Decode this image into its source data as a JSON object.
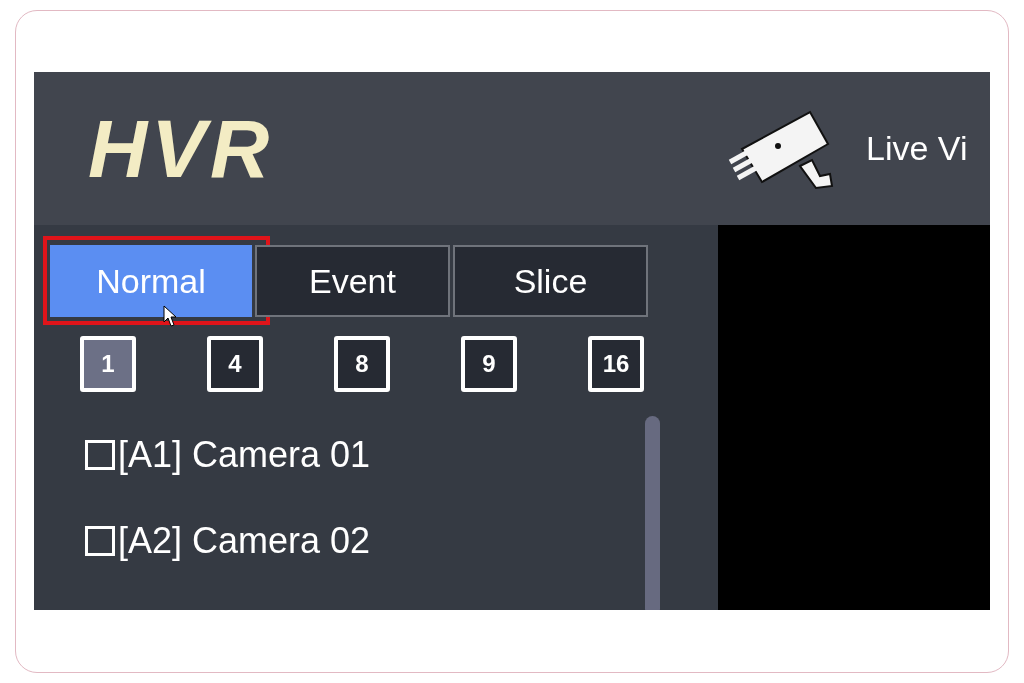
{
  "header": {
    "logo": "HVR",
    "nav_item": "Live Vi"
  },
  "tabs": [
    {
      "label": "Normal",
      "selected": true,
      "highlighted": true
    },
    {
      "label": "Event",
      "selected": false,
      "highlighted": false
    },
    {
      "label": "Slice",
      "selected": false,
      "highlighted": false
    }
  ],
  "layouts": [
    {
      "label": "1",
      "selected": true
    },
    {
      "label": "4",
      "selected": false
    },
    {
      "label": "8",
      "selected": false
    },
    {
      "label": "9",
      "selected": false
    },
    {
      "label": "16",
      "selected": false
    }
  ],
  "cameras": [
    {
      "label": "[A1] Camera 01",
      "checked": false
    },
    {
      "label": "[A2] Camera 02",
      "checked": false
    }
  ]
}
